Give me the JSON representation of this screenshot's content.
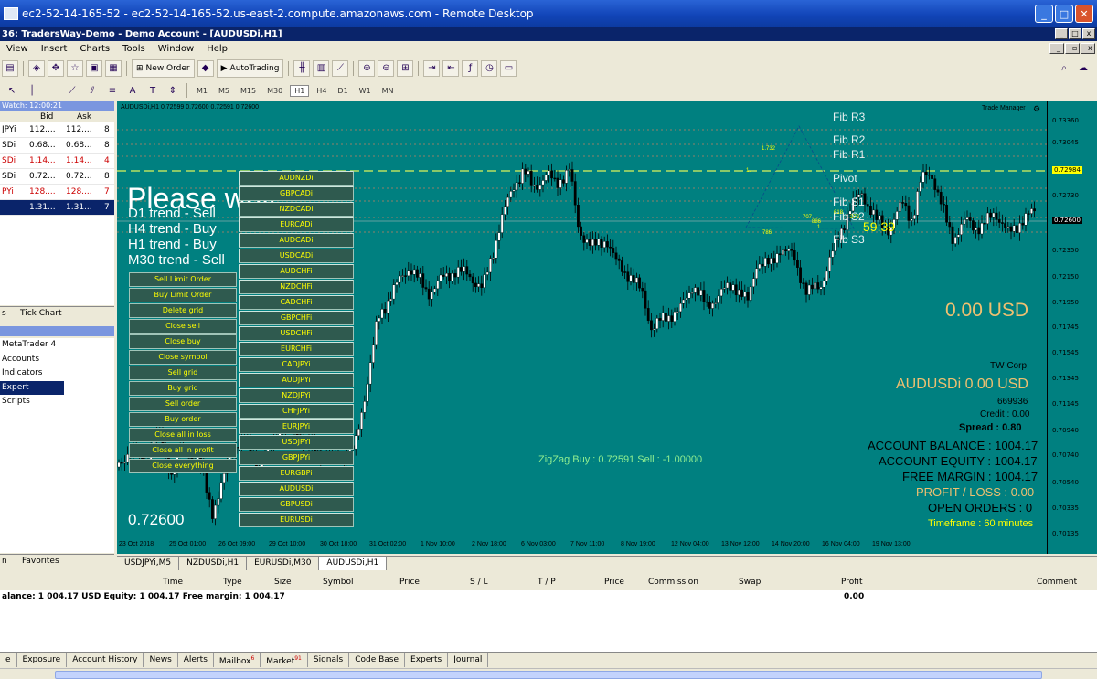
{
  "rd_title": "ec2-52-14-165-52 - ec2-52-14-165-52.us-east-2.compute.amazonaws.com - Remote Desktop",
  "mt_title": "36: TradersWay-Demo - Demo Account - [AUDUSDi,H1]",
  "menu": [
    "View",
    "Insert",
    "Charts",
    "Tools",
    "Window",
    "Help"
  ],
  "toolbar": {
    "new_order": "New Order",
    "autotrading": "AutoTrading"
  },
  "timeframes": [
    "M1",
    "M5",
    "M15",
    "M30",
    "H1",
    "H4",
    "D1",
    "W1",
    "MN"
  ],
  "tf_active": "H1",
  "market_watch": {
    "header": "Watch: 12:00:21",
    "col_bid": "Bid",
    "col_ask": "Ask",
    "rows": [
      {
        "sym": "JPYi",
        "bid": "112....",
        "ask": "112....",
        "n": "8",
        "color": "#000"
      },
      {
        "sym": "SDi",
        "bid": "0.68...",
        "ask": "0.68...",
        "n": "8",
        "color": "#000"
      },
      {
        "sym": "SDi",
        "bid": "1.14...",
        "ask": "1.14...",
        "n": "4",
        "color": "#c00"
      },
      {
        "sym": "SDi",
        "bid": "0.72...",
        "ask": "0.72...",
        "n": "8",
        "color": "#000"
      },
      {
        "sym": "PYi",
        "bid": "128....",
        "ask": "128....",
        "n": "7",
        "color": "#c00"
      },
      {
        "sym": "",
        "bid": "1.31...",
        "ask": "1.31...",
        "n": "7",
        "color": "#fff"
      }
    ],
    "tab_a": "s",
    "tab_b": "Tick Chart"
  },
  "navigator": {
    "items": [
      "MetaTrader 4",
      "Accounts",
      "Indicators",
      "Expert Advisors",
      "Scripts"
    ],
    "tab_a": "n",
    "tab_b": "Favorites"
  },
  "chart": {
    "info": "AUDUSDi,H1  0.72599 0.72600 0.72591 0.72600",
    "trade_manager": "Trade Manager",
    "please_wait": "Please wait",
    "trends": [
      "D1 trend - Sell",
      "H4 trend -  Buy",
      "H1 trend -  Buy",
      "M30 trend - Sell"
    ],
    "price": "0.72600",
    "pairs": [
      "AUDNZDi",
      "GBPCADi",
      "NZDCADi",
      "EURCADi",
      "AUDCADi",
      "USDCADi",
      "AUDCHFi",
      "NZDCHFi",
      "CADCHFi",
      "GBPCHFi",
      "USDCHFi",
      "EURCHFi",
      "CADJPYi",
      "AUDJPYi",
      "NZDJPYi",
      "CHFJPYi",
      "EURJPYi",
      "USDJPYi",
      "GBPJPYi",
      "EURGBPi",
      "AUDUSDi",
      "GBPUSDi",
      "EURUSDi"
    ],
    "actions": [
      "Sell Limit Order",
      "Buy Limit Order",
      "Delete grid",
      "Close sell",
      "Close buy",
      "Close symbol",
      "Sell grid",
      "Buy grid",
      "Sell order",
      "Buy order",
      "Close all in loss",
      "Close all in profit",
      "Close everything"
    ],
    "fib": [
      "Fib R3",
      "Fib R2",
      "Fib R1",
      "Pivot",
      "Fib S1",
      "Fib S2",
      "Fib S3"
    ],
    "countdown": "59:39",
    "usd_big": "0.00 USD",
    "zigzag": "ZigZag   Buy : 0.72591    Sell : -1.00000",
    "corp": "TW Corp",
    "acct_no": "669936",
    "credit": "Credit : 0.00",
    "symbol_usd": "AUDUSDi   0.00 USD",
    "spread": "Spread : 0.80",
    "balance": "ACCOUNT BALANCE : 1004.17",
    "equity": "ACCOUNT EQUITY : 1004.17",
    "free_margin": "FREE MARGIN : 1004.17",
    "profit_loss": "PROFIT / LOSS : 0.00",
    "open_orders": "OPEN ORDERS : 0",
    "timeframe": "Timeframe : 60 minutes",
    "fib_labels": [
      "1.732",
      "1.",
      "707",
      "786",
      "886",
      "1.",
      "618",
      "272"
    ],
    "price_ticks": [
      "0.73360",
      "0.73045",
      "0.72984",
      "0.72730",
      "0.72600",
      "0.72350",
      "0.72150",
      "0.71950",
      "0.71745",
      "0.71545",
      "0.71345",
      "0.71145",
      "0.70940",
      "0.70740",
      "0.70540",
      "0.70335",
      "0.70135"
    ],
    "time_ticks": [
      "23 Oct 2018",
      "25 Oct 01:00",
      "26 Oct 09:00",
      "29 Oct 10:00",
      "30 Oct 18:00",
      "31 Oct 02:00",
      "1 Nov 10:00",
      "2 Nov 18:00",
      "6 Nov 03:00",
      "7 Nov 11:00",
      "8 Nov 19:00",
      "12 Nov 04:00",
      "13 Nov 12:00",
      "14 Nov 20:00",
      "16 Nov 04:00",
      "19 Nov 13:00"
    ]
  },
  "chart_tabs": [
    "USDJPYi,M5",
    "NZDUSDi,H1",
    "EURUSDi,M30",
    "AUDUSDi,H1"
  ],
  "chart_tab_active": "AUDUSDi,H1",
  "terminal": {
    "cols": [
      "Time",
      "Type",
      "Size",
      "Symbol",
      "Price",
      "S / L",
      "T / P",
      "Price",
      "Commission",
      "Swap",
      "Profit",
      "Comment"
    ],
    "balance_line": "alance: 1 004.17 USD  Equity: 1 004.17  Free margin: 1 004.17",
    "profit": "0.00",
    "tabs": [
      "e",
      "Exposure",
      "Account History",
      "News",
      "Alerts",
      "Mailbox",
      "Market",
      "Signals",
      "Code Base",
      "Experts",
      "Journal"
    ],
    "mailbox_badge": "6",
    "market_badge": "91"
  }
}
